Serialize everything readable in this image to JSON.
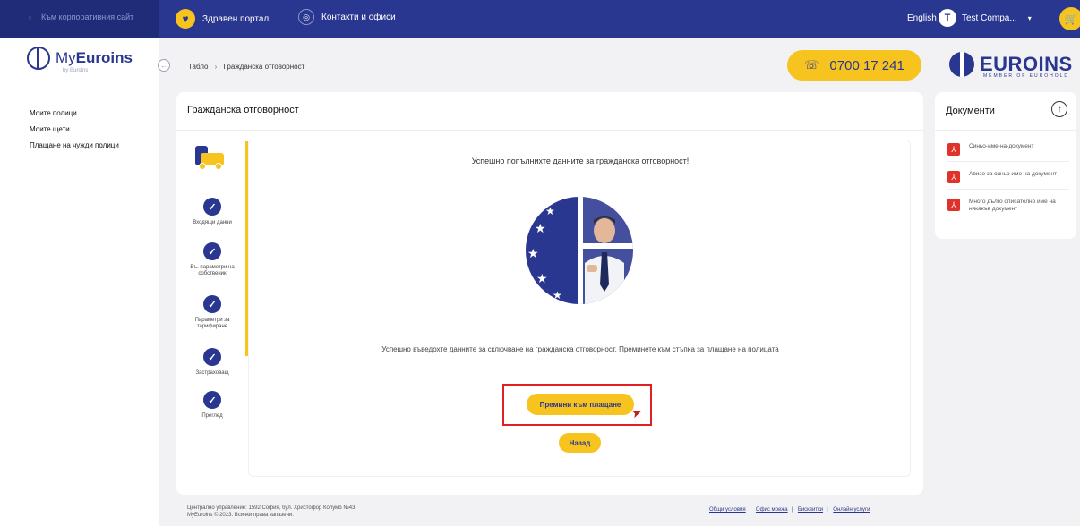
{
  "topbar": {
    "corporate_link": "Към корпоративния сайт",
    "health_portal": "Здравен портал",
    "contacts": "Контакти и офиси",
    "language": "English",
    "user_initial": "T",
    "user_name": "Test Compa..."
  },
  "sidebar": {
    "logo_name_light": "My",
    "logo_name_bold": "Euroins",
    "logo_sub": "by Euroins",
    "items": [
      {
        "label": "Моите полици"
      },
      {
        "label": "Моите щети"
      },
      {
        "label": "Плащане на чужди полици"
      }
    ]
  },
  "header": {
    "breadcrumb_home": "Табло",
    "breadcrumb_current": "Гражданска отговорност",
    "phone": "0700 17 241",
    "brand": "EUROINS",
    "brand_tagline": "MEMBER OF EUROHOLD"
  },
  "main": {
    "title": "Гражданска отговорност",
    "steps": [
      {
        "label": "Входящи данни"
      },
      {
        "label": "Въ. параметри на собственик"
      },
      {
        "label": "Параметри за тарифиране"
      },
      {
        "label": "Застраховащ"
      },
      {
        "label": "Преглед"
      }
    ],
    "success_heading": "Успешно попълнихте данните за гражданска отговорност!",
    "success_message": "Успешно въведохте данните за сключване на гражданска отговорност. Преминете към стъпка за плащане на полицата",
    "pay_button": "Премини към плащане",
    "back_button": "Назад"
  },
  "documents": {
    "title": "Документи",
    "items": [
      {
        "label": "Синьо-име-на-документ"
      },
      {
        "label": "Авизо за синьо име на документ"
      },
      {
        "label": "Много дълго описателно име на някакъв документ"
      }
    ]
  },
  "footer": {
    "address": "Централно управление: 1592 София, бул. Христофор Колумб №43",
    "copyright": "MyEuroins © 2023. Всички права запазени.",
    "links": [
      {
        "label": "Общи условия"
      },
      {
        "label": "Офис мрежа"
      },
      {
        "label": "Бисквитки"
      },
      {
        "label": "Онлайн услуги"
      }
    ]
  },
  "colors": {
    "brand_blue": "#2a3790",
    "accent_yellow": "#f7c41f",
    "highlight_red": "#e02020"
  }
}
